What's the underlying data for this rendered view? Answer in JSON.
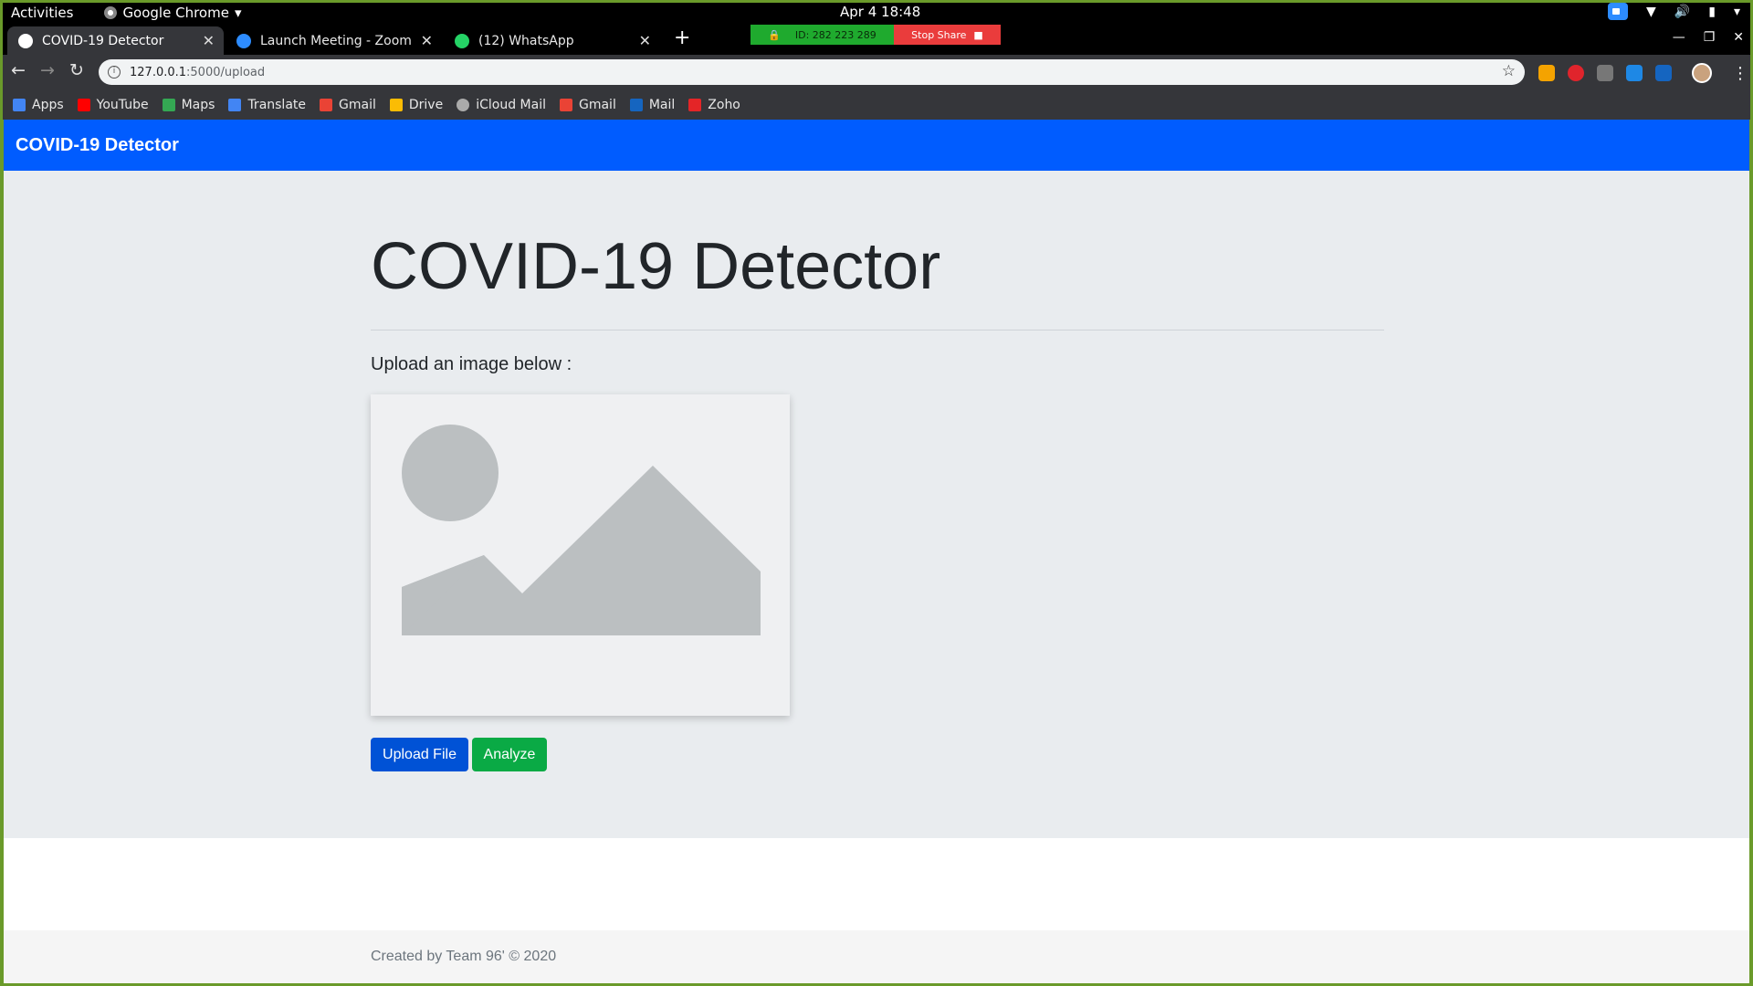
{
  "system": {
    "activities": "Activities",
    "app_menu": "Google Chrome",
    "clock": "Apr 4  18:48"
  },
  "tabs": [
    {
      "title": "COVID-19 Detector",
      "active": true
    },
    {
      "title": "Launch Meeting - Zoom",
      "active": false
    },
    {
      "title": "(12) WhatsApp",
      "active": false
    }
  ],
  "zoom_bar": {
    "meeting_id": "ID: 282 223 289",
    "stop_share": "Stop Share"
  },
  "address": {
    "host": "127.0.0.1",
    "path": ":5000/upload"
  },
  "bookmarks": [
    {
      "label": "Apps",
      "icon": "apps-grid-icon",
      "color": "#4285f4"
    },
    {
      "label": "YouTube",
      "icon": "youtube-icon",
      "color": "#ff0000"
    },
    {
      "label": "Maps",
      "icon": "maps-icon",
      "color": "#34a853"
    },
    {
      "label": "Translate",
      "icon": "translate-icon",
      "color": "#4285f4"
    },
    {
      "label": "Gmail",
      "icon": "gmail-icon",
      "color": "#ea4335"
    },
    {
      "label": "Drive",
      "icon": "drive-icon",
      "color": "#fbbc04"
    },
    {
      "label": "iCloud Mail",
      "icon": "apple-icon",
      "color": "#aaaaaa"
    },
    {
      "label": "Gmail",
      "icon": "gmail-icon",
      "color": "#ea4335"
    },
    {
      "label": "Mail",
      "icon": "mail-icon",
      "color": "#1565c0"
    },
    {
      "label": "Zoho",
      "icon": "zoho-icon",
      "color": "#e42527"
    }
  ],
  "page": {
    "navbar_brand": "COVID-19 Detector",
    "heading": "COVID-19 Detector",
    "lead": "Upload an image below :",
    "upload_button": "Upload File",
    "analyze_button": "Analyze",
    "footer": "Created by Team 96' © 2020"
  },
  "colors": {
    "navbar": "#005cff",
    "upload_button": "#0052d6",
    "analyze_button": "#0aaa45",
    "jumbotron": "#e9ecef"
  }
}
